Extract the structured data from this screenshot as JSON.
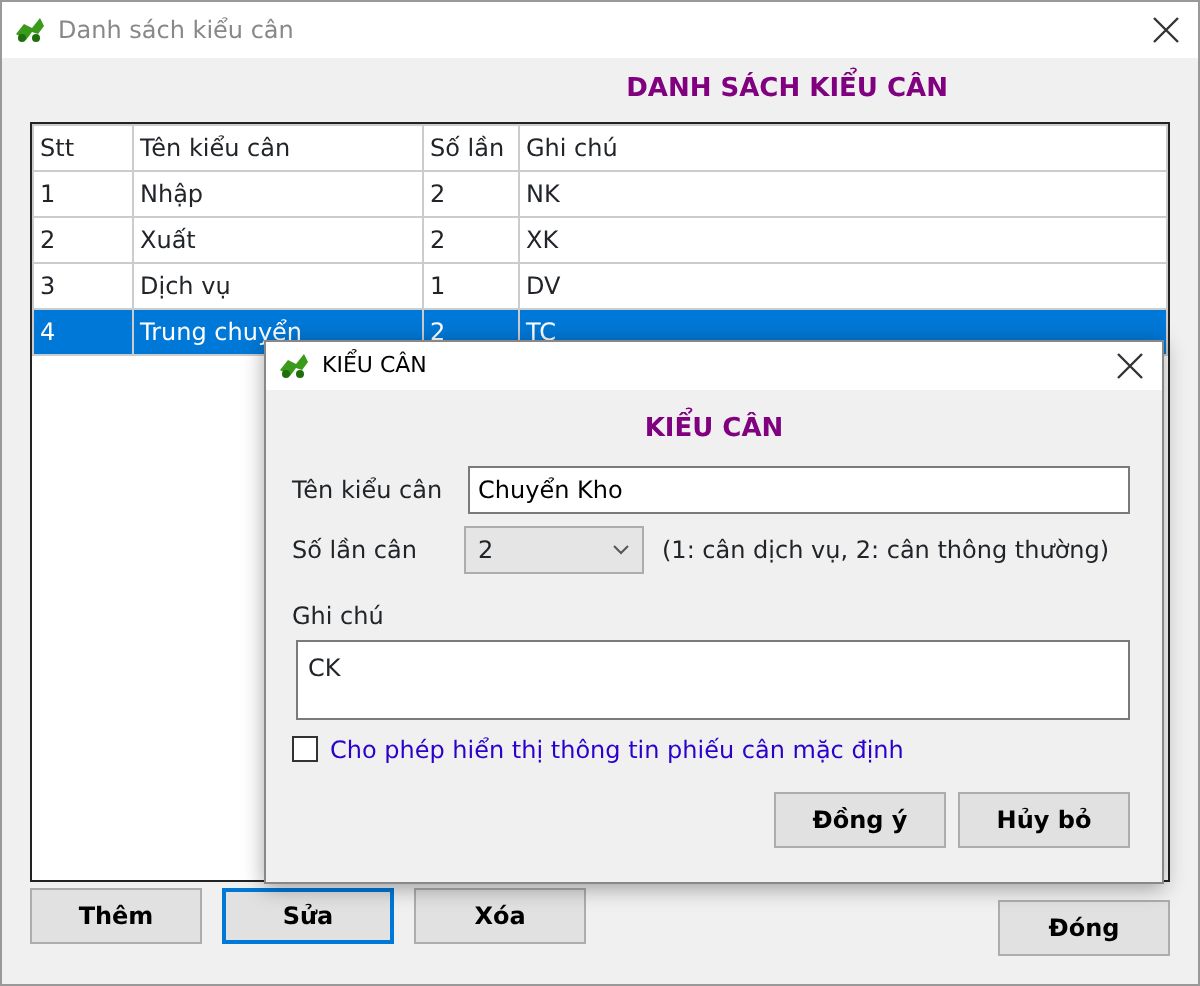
{
  "window": {
    "title": "Danh sách kiểu cân"
  },
  "heading": "DANH SÁCH KIỂU CÂN",
  "table": {
    "columns": [
      "Stt",
      "Tên kiểu cân",
      "Số lần",
      "Ghi chú"
    ],
    "rows": [
      {
        "cells": [
          "1",
          "Nhập",
          "2",
          "NK"
        ],
        "selected": false
      },
      {
        "cells": [
          "2",
          "Xuất",
          "2",
          "XK"
        ],
        "selected": false
      },
      {
        "cells": [
          "3",
          "Dịch vụ",
          "1",
          "DV"
        ],
        "selected": false
      },
      {
        "cells": [
          "4",
          "Trung chuyển",
          "2",
          "TC"
        ],
        "selected": true
      }
    ]
  },
  "buttons": [
    {
      "label": "Thêm",
      "focused": false
    },
    {
      "label": "Sửa",
      "focused": true
    },
    {
      "label": "Xóa",
      "focused": false
    }
  ],
  "close_button": "Đóng",
  "dialog": {
    "title": "KIỂU CÂN",
    "heading": "KIỂU CÂN",
    "name_label": "Tên kiểu cân",
    "name_value": "Chuyển Kho",
    "count_label": "Số lần cân",
    "count_value": "2",
    "count_hint": "(1: cân dịch vụ, 2: cân thông thường)",
    "note_label": "Ghi chú",
    "note_value": "CK",
    "checkbox": {
      "label": "Cho phép hiển thị thông tin phiếu cân mặc định",
      "checked": false
    },
    "buttons": [
      "Đồng ý",
      "Hủy bỏ"
    ]
  }
}
